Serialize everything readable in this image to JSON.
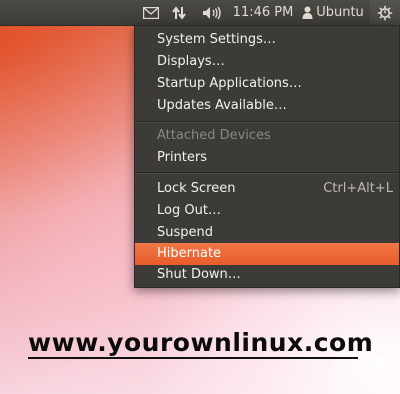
{
  "panel": {
    "icons": {
      "mail": "envelope-icon",
      "network": "network-updown-icon",
      "sound": "speaker-icon",
      "user": "person-icon",
      "session": "gear-power-icon"
    },
    "clock": "11:46 PM",
    "user_name": "Ubuntu"
  },
  "menu": {
    "items": [
      {
        "label": "System Settings…"
      },
      {
        "label": "Displays…"
      },
      {
        "label": "Startup Applications…"
      },
      {
        "label": "Updates Available…"
      },
      {
        "label": "Attached Devices"
      },
      {
        "label": "Printers"
      },
      {
        "label": "Lock Screen",
        "accel": "Ctrl+Alt+L"
      },
      {
        "label": "Log Out…"
      },
      {
        "label": "Suspend"
      },
      {
        "label": "Hibernate"
      },
      {
        "label": "Shut Down…"
      }
    ],
    "highlight_color": "#f07746",
    "background_color": "#3c3b37"
  },
  "watermark": "www.yourownlinux.com"
}
